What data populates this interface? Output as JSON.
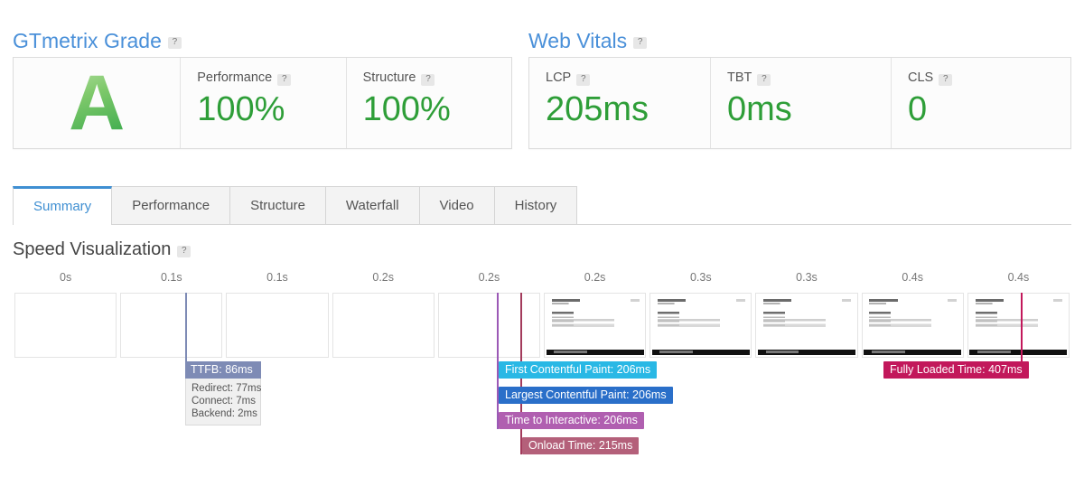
{
  "gtmetrix_grade": {
    "heading": "GTmetrix Grade",
    "help": "?",
    "grade": "A",
    "metrics": [
      {
        "label": "Performance",
        "help": "?",
        "value": "100%"
      },
      {
        "label": "Structure",
        "help": "?",
        "value": "100%"
      }
    ]
  },
  "web_vitals": {
    "heading": "Web Vitals",
    "help": "?",
    "metrics": [
      {
        "label": "LCP",
        "help": "?",
        "value": "205ms"
      },
      {
        "label": "TBT",
        "help": "?",
        "value": "0ms"
      },
      {
        "label": "CLS",
        "help": "?",
        "value": "0"
      }
    ]
  },
  "tabs": [
    {
      "label": "Summary",
      "active": true
    },
    {
      "label": "Performance",
      "active": false
    },
    {
      "label": "Structure",
      "active": false
    },
    {
      "label": "Waterfall",
      "active": false
    },
    {
      "label": "Video",
      "active": false
    },
    {
      "label": "History",
      "active": false
    }
  ],
  "speed_visualization": {
    "heading": "Speed Visualization",
    "help": "?",
    "tick_labels": [
      "0s",
      "0.1s",
      "0.1s",
      "0.2s",
      "0.2s",
      "0.2s",
      "0.3s",
      "0.3s",
      "0.4s",
      "0.4s"
    ],
    "ttfb": {
      "title": "TTFB: 86ms",
      "breakdown": [
        "Redirect: 77ms",
        "Connect: 7ms",
        "Backend: 2ms"
      ],
      "color": "#7e8bb5"
    },
    "markers": [
      {
        "name": "first-contentful-paint",
        "label": "First Contentful Paint: 206ms",
        "color": "#29b8e5",
        "line_color": "#9b59b6"
      },
      {
        "name": "largest-contentful-paint",
        "label": "Largest Contentful Paint: 206ms",
        "color": "#2a6fc9",
        "line_color": "#9b59b6"
      },
      {
        "name": "time-to-interactive",
        "label": "Time to Interactive: 206ms",
        "color": "#b05fb0",
        "line_color": "#9b59b6"
      },
      {
        "name": "onload-time",
        "label": "Onload Time: 215ms",
        "color": "#b4607a",
        "line_color": "#a33b5c"
      },
      {
        "name": "fully-loaded-time",
        "label": "Fully Loaded Time: 407ms",
        "color": "#c2185b",
        "line_color": "#c2185b"
      }
    ],
    "frame_count": 10,
    "blank_frames": 5
  },
  "colors": {
    "heading_blue": "#4a90d9",
    "score_green": "#2e9e38",
    "tab_active": "#3f8fd2"
  }
}
